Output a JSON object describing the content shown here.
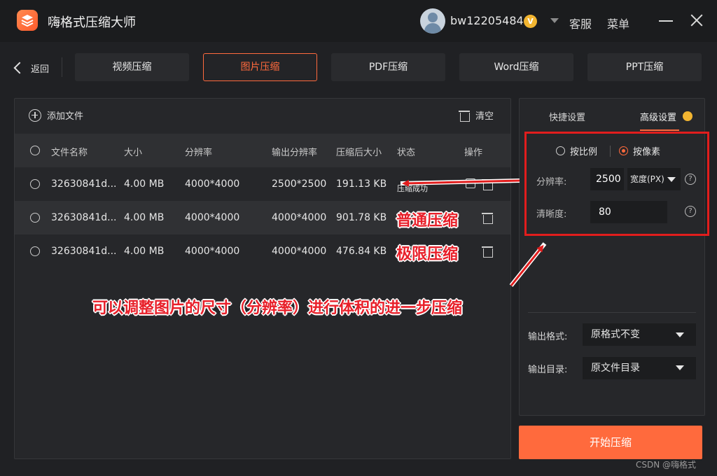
{
  "app": {
    "title": "嗨格式压缩大师"
  },
  "user": {
    "name": "bw12205484",
    "vip_badge": "V"
  },
  "top_links": {
    "support": "客服",
    "menu": "菜单"
  },
  "nav": {
    "back_label": "返回",
    "tabs": [
      {
        "label": "视频压缩",
        "active": false
      },
      {
        "label": "图片压缩",
        "active": true
      },
      {
        "label": "PDF压缩",
        "active": false
      },
      {
        "label": "Word压缩",
        "active": false
      },
      {
        "label": "PPT压缩",
        "active": false
      }
    ]
  },
  "file_panel": {
    "add_file_label": "添加文件",
    "clear_label": "清空",
    "columns": [
      "文件名称",
      "大小",
      "分辨率",
      "输出分辨率",
      "压缩后大小",
      "状态",
      "操作"
    ],
    "rows": [
      {
        "name": "32630841d...",
        "size": "4.00 MB",
        "resolution": "4000*4000",
        "output_resolution": "2500*2500",
        "compressed_size": "191.13 KB",
        "status": "压缩成功"
      },
      {
        "name": "32630841d...",
        "size": "4.00 MB",
        "resolution": "4000*4000",
        "output_resolution": "4000*4000",
        "compressed_size": "901.78 KB",
        "status": ""
      },
      {
        "name": "32630841d...",
        "size": "4.00 MB",
        "resolution": "4000*4000",
        "output_resolution": "4000*4000",
        "compressed_size": "476.84 KB",
        "status": ""
      }
    ]
  },
  "settings": {
    "tabs": [
      "快捷设置",
      "高级设置"
    ],
    "mode_options": [
      "按比例",
      "按像素"
    ],
    "selected_mode": "按像素",
    "resolution_label": "分辨率:",
    "resolution_value": "2500",
    "resolution_unit": "宽度(PX)",
    "clarity_label": "清晰度:",
    "clarity_value": "80",
    "help_glyph": "?",
    "output_format_label": "输出格式:",
    "output_format_value": "原格式不变",
    "output_dir_label": "输出目录:",
    "output_dir_value": "原文件目录"
  },
  "start_button": "开始压缩",
  "annotations": {
    "normal": "普通压缩",
    "extreme": "极限压缩",
    "note": "可以调整图片的尺寸（分辨率）进行体积的进一步压缩"
  },
  "watermark": "CSDN @嗨格式",
  "colors": {
    "accent": "#ff6a3d",
    "annotation_red": "#e11d1d",
    "background": "#202124"
  }
}
